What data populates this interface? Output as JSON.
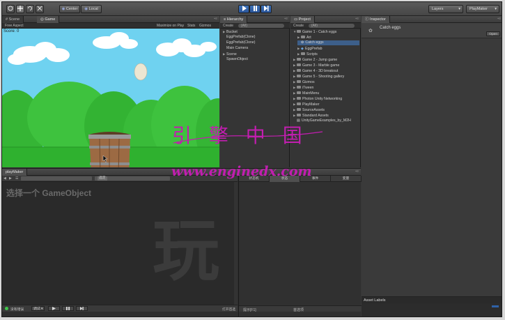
{
  "toolbar": {
    "pivot_label": "Center",
    "space_label": "Local",
    "layers_label": "Layers",
    "layout_label": "PlayMaker"
  },
  "scene_tab": {
    "label": "Scene"
  },
  "game_tab": {
    "label": "Game"
  },
  "game": {
    "aspect_label": "Free Aspect",
    "maximize_label": "Maximize on Play",
    "stats_label": "Stats",
    "gizmos_label": "Gizmos",
    "score_text": "Score: 0"
  },
  "hierarchy": {
    "title": "Hierarchy",
    "create_label": "Create",
    "search_placeholder": "(All)",
    "items": [
      {
        "label": "Bucket",
        "expand": "▶"
      },
      {
        "label": "EggPrefab(Clone)",
        "expand": ""
      },
      {
        "label": "EggPrefab(Clone)",
        "expand": ""
      },
      {
        "label": "Main Camera",
        "expand": ""
      },
      {
        "label": "Scene",
        "expand": "▶"
      },
      {
        "label": "SpawnObject",
        "expand": ""
      }
    ]
  },
  "project": {
    "title": "Project",
    "create_label": "Create",
    "search_placeholder": "(All)",
    "items": [
      {
        "label": "Game 1 - Catch eggs",
        "expand": "▼",
        "indent": 0,
        "kind": "folder"
      },
      {
        "label": "Art",
        "expand": "▶",
        "indent": 1,
        "kind": "folder"
      },
      {
        "label": "Catch eggs",
        "expand": "",
        "indent": 1,
        "kind": "unity",
        "selected": true
      },
      {
        "label": "EggPrefab",
        "expand": "▶",
        "indent": 1,
        "kind": "prefab"
      },
      {
        "label": "Scripts",
        "expand": "▶",
        "indent": 1,
        "kind": "folder"
      },
      {
        "label": "Game 2 - Jump game",
        "expand": "▶",
        "indent": 0,
        "kind": "folder"
      },
      {
        "label": "Game 3 - Marble game",
        "expand": "▶",
        "indent": 0,
        "kind": "folder"
      },
      {
        "label": "Game 4 - 3D breakout",
        "expand": "▶",
        "indent": 0,
        "kind": "folder"
      },
      {
        "label": "Game 5 - Shooting gallery",
        "expand": "▶",
        "indent": 0,
        "kind": "folder"
      },
      {
        "label": "Gizmos",
        "expand": "▶",
        "indent": 0,
        "kind": "folder"
      },
      {
        "label": "iTween",
        "expand": "▶",
        "indent": 0,
        "kind": "folder"
      },
      {
        "label": "MainMenu",
        "expand": "▶",
        "indent": 0,
        "kind": "folder"
      },
      {
        "label": "Photon Unity Networking",
        "expand": "▶",
        "indent": 0,
        "kind": "folder"
      },
      {
        "label": "PlayMaker",
        "expand": "▶",
        "indent": 0,
        "kind": "folder"
      },
      {
        "label": "SourceAssets",
        "expand": "▶",
        "indent": 0,
        "kind": "folder"
      },
      {
        "label": "Standard Assets",
        "expand": "▶",
        "indent": 0,
        "kind": "folder"
      },
      {
        "label": "UnityGameExamples_by_M2H",
        "expand": "",
        "indent": 0,
        "kind": "file"
      }
    ]
  },
  "inspector": {
    "title": "Inspector",
    "object_name": "Catch eggs",
    "open_label": "Open",
    "asset_labels": "Asset Labels"
  },
  "playmaker": {
    "title": "playMaker",
    "selector_label": "选定",
    "hint": "选择一个 GameObject",
    "watermark_glyph": "玩",
    "tabs": [
      "状态机",
      "状态",
      "事件",
      "变量"
    ],
    "bottom_checkbox_label": "没有错误",
    "bottom_dropdown_label": "调试",
    "prefs_label": "打开首选",
    "hints_label": "提示[F1]",
    "preferences_label": "首选项"
  },
  "overlay": {
    "chinese_text": "引 擎 中 国",
    "url_text": "www.enginedx.com"
  },
  "colors": {
    "sky": "#6fd2f0",
    "hills": "#3ec23e",
    "grass": "#2fb12f",
    "watermark": "#c21eb0",
    "play_blue": "#2f62a8"
  }
}
